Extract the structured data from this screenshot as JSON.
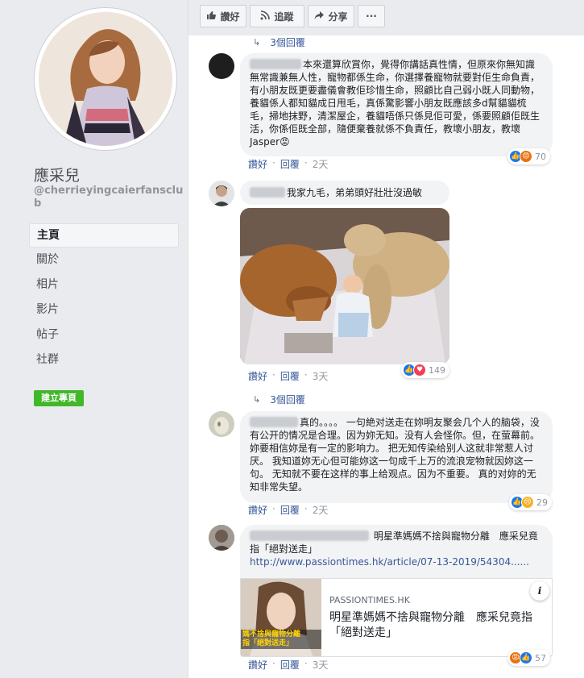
{
  "page": {
    "name": "應采兒",
    "handle": "@cherrieyingcaierfansclub",
    "nav": [
      "主頁",
      "關於",
      "相片",
      "影片",
      "帖子",
      "社群"
    ],
    "create_page": "建立專頁"
  },
  "toolbar": {
    "like": "讚好",
    "follow": "追蹤",
    "share": "分享",
    "more": "···"
  },
  "feed": {
    "top_replies": "3個回覆",
    "comment1": {
      "text": "本來還算欣賞你，覺得你講話真性情，但原來你無知識無常識兼無人性，寵物都係生命，你選擇養寵物就要對佢生命負責，有小朋友既更要盡儀會教佢珍惜生命，照顧比自己弱小既人同動物，養貓係人都知貓成日甩毛，真係驚影響小朋友既應該多d幫貓貓梳毛，掃地抹野，清潔屋企，養貓唔係只係見佢可愛，係要照顧佢既生活，你係佢既全部，隨便棄養就係不負責任，教壞小朋友，教壞Jasper😡",
      "like": "讚好",
      "reply": "回覆",
      "time": "2天",
      "reactions": [
        "like",
        "angry"
      ],
      "count": "70"
    },
    "comment2": {
      "text": "我家九毛，弟弟頭好壯壯沒過敏",
      "like": "讚好",
      "reply": "回覆",
      "time": "3天",
      "reactions": [
        "like",
        "love"
      ],
      "count": "149"
    },
    "mid_replies": "3個回覆",
    "comment3": {
      "text": "真的。。。。 一句絶对送走在妳明友聚会几个人的脑袋，没有公开的情况是合理。因为妳无知。没有人会怪你。但，在萤幕前。妳要相信妳是有一定的影响力。 把无知传染给别人这就非常惹人讨厌。 我知道妳无心但可能妳这一句成千上万的流浪宠物就因妳这一句。 无知就不要在这样的事上给观点。因为不重要。 真的对妳的无知非常失望。",
      "like": "讚好",
      "reply": "回覆",
      "time": "2天",
      "reactions": [
        "like",
        "sad"
      ],
      "count": "29"
    },
    "comment4": {
      "text": "明星準媽媽不捨與寵物分離　應采兒竟指「絕對送走」",
      "url": "http://www.passiontimes.hk/article/07-13-2019/54304......",
      "link_source": "PASSIONTIMES.HK",
      "link_title": "明星準媽媽不捨與寵物分離　應采兒竟指「絕對送走」",
      "thumb_caption_1": "媽不捨與寵物分離",
      "thumb_caption_2": "指「絕對送走」",
      "info": "i",
      "like": "讚好",
      "reply": "回覆",
      "time": "3天",
      "reactions": [
        "angry",
        "like"
      ],
      "count": "57"
    }
  }
}
